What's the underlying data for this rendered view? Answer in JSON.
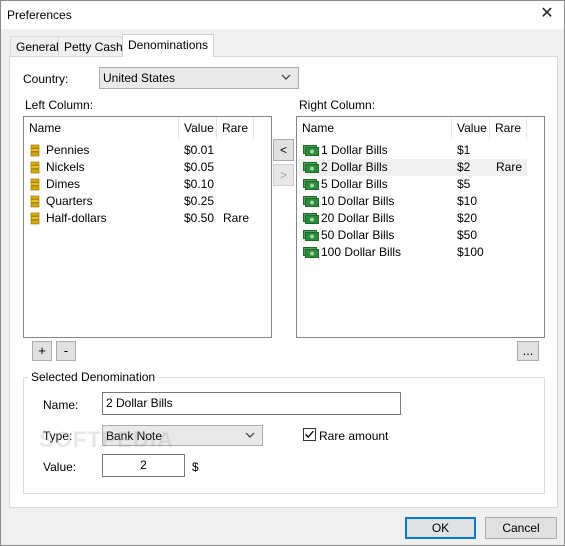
{
  "window": {
    "title": "Preferences"
  },
  "tabs": [
    "General",
    "Petty Cash",
    "Denominations"
  ],
  "country": {
    "label": "Country:",
    "value": "United States"
  },
  "left": {
    "label": "Left Column:",
    "headers": [
      "Name",
      "Value",
      "Rare"
    ],
    "rows": [
      {
        "icon": "coin-icon",
        "name": "Pennies",
        "value": "$0.01",
        "rare": ""
      },
      {
        "icon": "coin-icon",
        "name": "Nickels",
        "value": "$0.05",
        "rare": ""
      },
      {
        "icon": "coin-icon",
        "name": "Dimes",
        "value": "$0.10",
        "rare": ""
      },
      {
        "icon": "coin-icon",
        "name": "Quarters",
        "value": "$0.25",
        "rare": ""
      },
      {
        "icon": "coin-icon",
        "name": "Half-dollars",
        "value": "$0.50",
        "rare": "Rare"
      }
    ]
  },
  "right": {
    "label": "Right Column:",
    "headers": [
      "Name",
      "Value",
      "Rare"
    ],
    "rows": [
      {
        "icon": "bill-icon",
        "name": "1 Dollar Bills",
        "value": "$1",
        "rare": ""
      },
      {
        "icon": "bill-icon",
        "name": "2 Dollar Bills",
        "value": "$2",
        "rare": "Rare",
        "selected": true
      },
      {
        "icon": "bill-icon",
        "name": "5 Dollar Bills",
        "value": "$5",
        "rare": ""
      },
      {
        "icon": "bill-icon",
        "name": "10 Dollar Bills",
        "value": "$10",
        "rare": ""
      },
      {
        "icon": "bill-icon",
        "name": "20 Dollar Bills",
        "value": "$20",
        "rare": ""
      },
      {
        "icon": "bill-icon",
        "name": "50 Dollar Bills",
        "value": "$50",
        "rare": ""
      },
      {
        "icon": "bill-icon",
        "name": "100 Dollar Bills",
        "value": "$100",
        "rare": ""
      }
    ]
  },
  "move": {
    "left": "<",
    "right": ">"
  },
  "list_buttons": {
    "add": "+",
    "remove": "-",
    "more": "..."
  },
  "selected": {
    "title": "Selected Denomination",
    "name_label": "Name:",
    "name_value": "2 Dollar Bills",
    "type_label": "Type:",
    "type_value": "Bank Note",
    "rare_label": "Rare amount",
    "rare_checked": true,
    "value_label": "Value:",
    "value_value": "2",
    "currency_symbol": "$"
  },
  "footer": {
    "ok": "OK",
    "cancel": "Cancel"
  },
  "watermark": "SOFTPEDIA",
  "colors": {
    "selection": "#f0f0f0",
    "default_button_border": "#0078d7",
    "coin": "#e0b000",
    "bill": "#2e8b3a"
  }
}
